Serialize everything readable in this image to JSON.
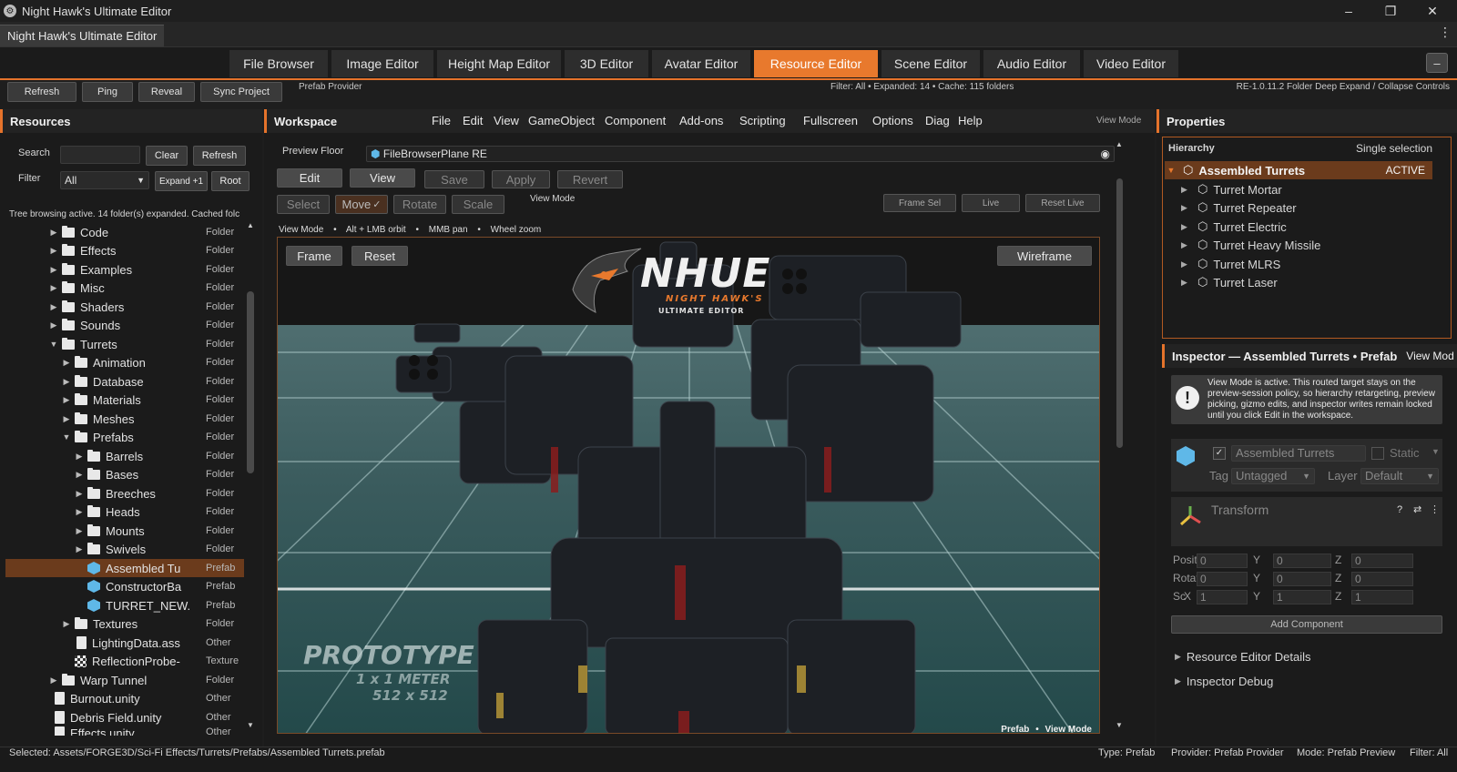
{
  "window": {
    "title": "Night Hawk's Ultimate Editor",
    "tab_label": "Night Hawk's Ultimate Editor"
  },
  "editor_tabs": [
    {
      "label": "File Browser"
    },
    {
      "label": "Image Editor"
    },
    {
      "label": "Height Map Editor"
    },
    {
      "label": "3D Editor"
    },
    {
      "label": "Avatar Editor"
    },
    {
      "label": "Resource Editor"
    },
    {
      "label": "Scene Editor"
    },
    {
      "label": "Audio Editor"
    },
    {
      "label": "Video Editor"
    }
  ],
  "active_editor_tab": "Resource Editor",
  "toolbar": {
    "refresh": "Refresh",
    "ping": "Ping",
    "reveal": "Reveal",
    "sync": "Sync Project",
    "provider": "Prefab Provider",
    "filter_info": "Filter: All • Expanded: 14 • Cache: 115 folders",
    "version": "RE-1.0.11.2 Folder Deep Expand / Collapse Controls"
  },
  "resources": {
    "title": "Resources",
    "search_label": "Search",
    "search_value": "",
    "clear": "Clear",
    "refresh": "Refresh",
    "filter_label": "Filter",
    "filter_value": "All",
    "expand": "Expand +1",
    "root": "Root",
    "status": "Tree browsing active. 14 folder(s) expanded. Cached folc",
    "tree": [
      {
        "name": "Code",
        "type": "Folder"
      },
      {
        "name": "Effects",
        "type": "Folder"
      },
      {
        "name": "Examples",
        "type": "Folder"
      },
      {
        "name": "Misc",
        "type": "Folder"
      },
      {
        "name": "Shaders",
        "type": "Folder"
      },
      {
        "name": "Sounds",
        "type": "Folder"
      },
      {
        "name": "Turrets",
        "type": "Folder"
      },
      {
        "name": "Animation",
        "type": "Folder"
      },
      {
        "name": "Database",
        "type": "Folder"
      },
      {
        "name": "Materials",
        "type": "Folder"
      },
      {
        "name": "Meshes",
        "type": "Folder"
      },
      {
        "name": "Prefabs",
        "type": "Folder"
      },
      {
        "name": "Barrels",
        "type": "Folder"
      },
      {
        "name": "Bases",
        "type": "Folder"
      },
      {
        "name": "Breeches",
        "type": "Folder"
      },
      {
        "name": "Heads",
        "type": "Folder"
      },
      {
        "name": "Mounts",
        "type": "Folder"
      },
      {
        "name": "Swivels",
        "type": "Folder"
      },
      {
        "name": "Assembled Tu",
        "type": "Prefab"
      },
      {
        "name": "ConstructorBa",
        "type": "Prefab"
      },
      {
        "name": "TURRET_NEW.",
        "type": "Prefab"
      },
      {
        "name": "Textures",
        "type": "Folder"
      },
      {
        "name": "LightingData.ass",
        "type": "Other"
      },
      {
        "name": "ReflectionProbe-",
        "type": "Texture"
      },
      {
        "name": "Warp Tunnel",
        "type": "Folder"
      },
      {
        "name": "Burnout.unity",
        "type": "Other"
      },
      {
        "name": "Debris Field.unity",
        "type": "Other"
      },
      {
        "name": "Effects.unity",
        "type": "Other"
      }
    ]
  },
  "workspace": {
    "title": "Workspace",
    "menu": [
      "File",
      "Edit",
      "View",
      "GameObject",
      "Component",
      "Add-ons",
      "Scripting",
      "Fullscreen",
      "Options",
      "Diag",
      "Help"
    ],
    "view_mode": "View Mode",
    "preview_floor_label": "Preview Floor",
    "preview_floor_value": "FileBrowserPlane RE",
    "edit": "Edit",
    "view": "View",
    "save": "Save",
    "apply": "Apply",
    "revert": "Revert",
    "select": "Select",
    "move": "Move",
    "rotate": "Rotate",
    "scale": "Scale",
    "mode_label": "View Mode",
    "frame_sel": "Frame Sel",
    "live": "Live",
    "reset_live": "Reset Live",
    "hint": [
      "View Mode",
      "Alt + LMB orbit",
      "MMB pan",
      "Wheel zoom"
    ],
    "frame": "Frame",
    "reset": "Reset",
    "wireframe": "Wireframe",
    "logo_big": "NHUE",
    "logo_sub1": "NIGHT HAWK'S",
    "logo_sub2": "ULTIMATE EDITOR",
    "floor_text1": "PROTOTYPE",
    "floor_text2": "1 x 1 METER",
    "floor_text3": "512 x 512",
    "footer_left": "Prefab",
    "footer_right": "View Mode"
  },
  "properties": {
    "title": "Properties",
    "hierarchy_title": "Hierarchy",
    "selection_mode": "Single selection",
    "root_item": "Assembled Turrets",
    "root_badge": "ACTIVE",
    "children": [
      "Turret Mortar",
      "Turret Repeater",
      "Turret Electric",
      "Turret Heavy Missile",
      "Turret MLRS",
      "Turret Laser"
    ],
    "inspector_title": "Inspector — Assembled Turrets • Prefab",
    "inspector_mode": "View Mod",
    "notice": "View Mode is active. This routed target stays on the preview-session policy, so hierarchy retargeting, preview picking, gizmo edits, and inspector writes remain locked until you click Edit in the workspace.",
    "object_name": "Assembled Turrets",
    "static_label": "Static",
    "tag_label": "Tag",
    "tag_value": "Untagged",
    "layer_label": "Layer",
    "layer_value": "Default",
    "transform_label": "Transform",
    "position_label": "PositiX",
    "rotation_label": "RotatiX",
    "scale_label": "Sc",
    "pos": [
      "0",
      "0",
      "0"
    ],
    "rot": [
      "0",
      "0",
      "0"
    ],
    "scl": [
      "1",
      "1",
      "1"
    ],
    "x": "X",
    "y": "Y",
    "z": "Z",
    "add_component": "Add Component",
    "details": "Resource Editor Details",
    "debug": "Inspector Debug"
  },
  "statusbar": {
    "selected": "Selected: Assets/FORGE3D/Sci-Fi Effects/Turrets/Prefabs/Assembled Turrets.prefab",
    "type": "Type: Prefab",
    "provider": "Provider: Prefab Provider",
    "mode": "Mode: Prefab Preview",
    "filter": "Filter: All"
  },
  "colors": {
    "accent": "#e8792d",
    "selected_row": "#6b3b1c",
    "cube_icon": "#5fb8e8"
  }
}
